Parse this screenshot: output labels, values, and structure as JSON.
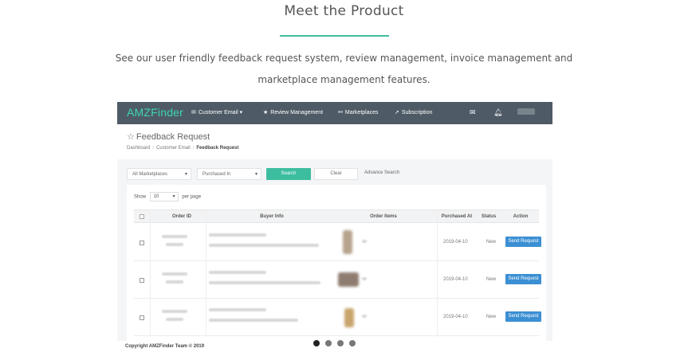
{
  "section": {
    "title": "Meet the Product",
    "description": "See our user friendly feedback request system, review management, invoice management and marketplace management features."
  },
  "app": {
    "brand": "AMZFinder",
    "nav": [
      {
        "label": "Customer Email ▾",
        "icon": "envelope-icon"
      },
      {
        "label": "Review Management",
        "icon": "star-icon"
      },
      {
        "label": "Marketplaces",
        "icon": "sitemap-icon"
      },
      {
        "label": "Subscription",
        "icon": "rocket-icon"
      }
    ],
    "page_title": "Feedback Request",
    "breadcrumb": [
      "Dashboard",
      "Customer Email",
      "Feedback Request"
    ],
    "filters": {
      "marketplace": "All Marketplaces",
      "date_field": "Purchased In",
      "search_label": "Search",
      "clear_label": "Clear",
      "advance_search": "Advance Search"
    },
    "show": {
      "prefix": "Show",
      "value": "10",
      "suffix": "per page"
    },
    "table": {
      "columns": [
        "Order ID",
        "Buyer Info",
        "Order Items",
        "Purchased At",
        "Status",
        "Action"
      ],
      "rows": [
        {
          "purchased_at": "2019-04-10",
          "status": "New",
          "action": "Send Request"
        },
        {
          "purchased_at": "2019-04-10",
          "status": "New",
          "action": "Send Request"
        },
        {
          "purchased_at": "2019-04-10",
          "status": "New",
          "action": "Send Request"
        }
      ]
    },
    "footer": "Copyright AMZFinder Team © 2019"
  },
  "carousel": {
    "count": 4,
    "active": 0
  },
  "colors": {
    "accent": "#3dbd9f",
    "navbar": "#4e5b66",
    "brand": "#3dd6ae",
    "action_button": "#3b8fd3"
  }
}
